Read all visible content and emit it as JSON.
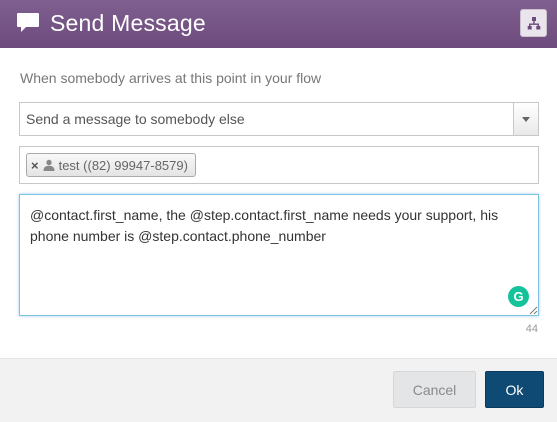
{
  "dialog": {
    "title": "Send Message",
    "header_icon": "chat-bubble-icon",
    "split_icon": "flow-split-icon"
  },
  "form": {
    "intro_text": "When somebody arrives at this point in your flow",
    "action_select": {
      "selected": "Send a message to somebody else"
    },
    "recipients": [
      {
        "label": "test ((82) 99947-8579)",
        "icon": "person-icon"
      }
    ],
    "message": {
      "value": "@contact.first_name, the @step.contact.first_name needs your support, his phone number is @step.contact.phone_number"
    },
    "char_count": "44",
    "grammarly_label": "G"
  },
  "footer": {
    "cancel_label": "Cancel",
    "ok_label": "Ok"
  },
  "colors": {
    "header": "#6d4c7d",
    "ok_button": "#0e4a73",
    "focus_border": "#7ec1e0",
    "grammarly": "#15c39a"
  }
}
